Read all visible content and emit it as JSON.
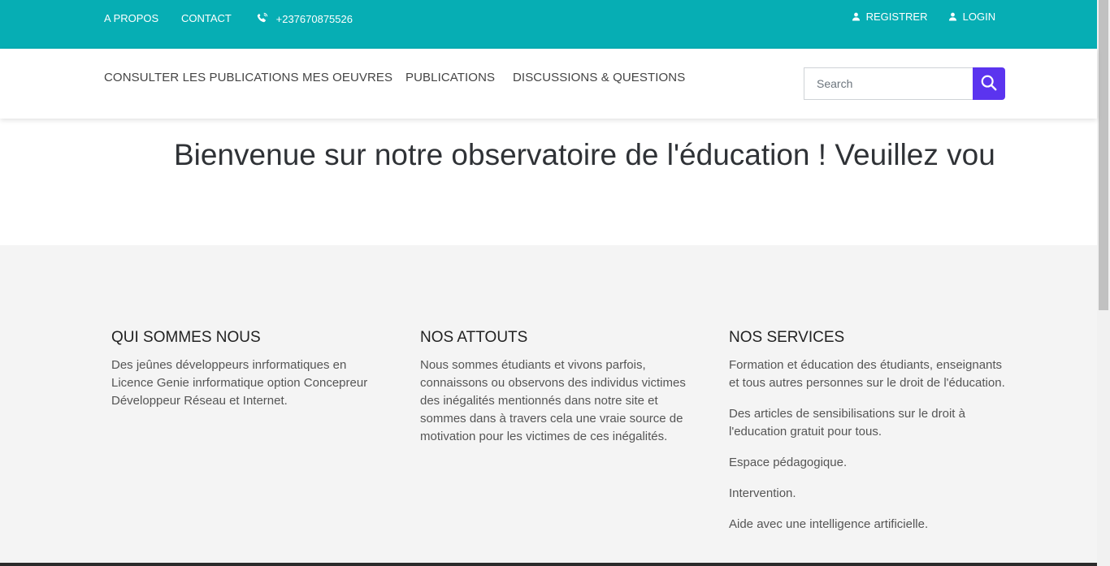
{
  "topbar": {
    "about": "A PROPOS",
    "contact": "CONTACT",
    "phone": "+237670875526",
    "register": "REGISTRER",
    "login": "LOGIN",
    "background_color": "#06aeb4"
  },
  "nav": {
    "items": [
      {
        "label": "CONSULTER LES PUBLICATIONS"
      },
      {
        "label": "MES OEUVRES"
      },
      {
        "label": "PUBLICATIONS"
      },
      {
        "label": "DISCUSSIONS & QUESTIONS"
      }
    ]
  },
  "search": {
    "placeholder": "Search",
    "button_icon": "search-icon",
    "button_color": "#5b34ef"
  },
  "hero": {
    "marquee_text": "Bienvenue sur notre observatoire de l'éducation ! Veuillez vou"
  },
  "info": {
    "who": {
      "title": "QUI SOMMES NOUS",
      "text": "Des jeûnes développeurs inrformatiques en Licence Genie inrformatique option Concepreur Développeur Réseau et Internet."
    },
    "assets": {
      "title": "NOS ATTOUTS",
      "text": "Nous sommes étudiants et vivons parfois, connaissons ou observons des individus victimes des inégalités mentionnés dans notre site et sommes dans à travers cela une vraie source de motivation pour les victimes de ces inégalités."
    },
    "services": {
      "title": "NOS SERVICES",
      "items": [
        "Formation et éducation des étudiants, enseignants et tous autres personnes sur le droit de l'éducation.",
        "Des articles de sensibilisations sur le droit à l'education gratuit pour tous.",
        "Espace pédagogique.",
        "Intervention.",
        "Aide avec une intelligence artificielle."
      ]
    }
  }
}
